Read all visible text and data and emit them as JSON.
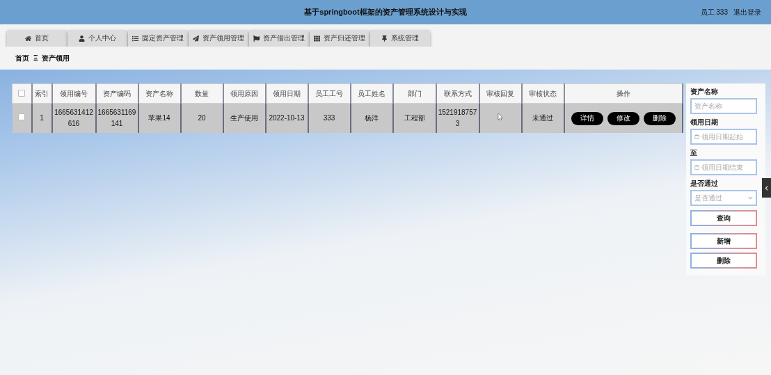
{
  "header": {
    "title": "基于springboot框架的资产管理系统设计与实现",
    "user": "员工 333",
    "logout": "退出登录"
  },
  "nav": [
    {
      "label": "首页",
      "selected": false
    },
    {
      "label": "个人中心",
      "selected": false
    },
    {
      "label": "固定资产管理",
      "selected": false
    },
    {
      "label": "资产领用管理",
      "selected": false
    },
    {
      "label": "资产借出管理",
      "selected": false
    },
    {
      "label": "资产归还管理",
      "selected": false
    },
    {
      "label": "系统管理",
      "selected": false
    }
  ],
  "breadcrumb": {
    "home": "首页",
    "separator": "Ξ",
    "current": "资产领用"
  },
  "table": {
    "select_all_checked": false,
    "columns": [
      "索引",
      "领用编号",
      "资产编码",
      "资产名称",
      "数量",
      "领用原因",
      "领用日期",
      "员工工号",
      "员工姓名",
      "部门",
      "联系方式",
      "审核回复",
      "审核状态",
      "操作"
    ],
    "rows": [
      {
        "checked": false,
        "cells": [
          "1",
          "1665631412616",
          "1665631169141",
          "苹果14",
          "20",
          "生产使用",
          "2022-10-13",
          "333",
          "杨洋",
          "工程部",
          "15219187573",
          "",
          "未通过"
        ],
        "actions": [
          "详情",
          "修改",
          "删除"
        ]
      }
    ]
  },
  "search": {
    "fields": [
      {
        "kind": "text",
        "label": "资产名称",
        "placeholder": "资产名称"
      },
      {
        "kind": "date",
        "label": "领用日期",
        "placeholder": "领用日期起始"
      },
      {
        "kind": "date",
        "label": "至",
        "placeholder": "领用日期结束"
      },
      {
        "kind": "select",
        "label": "是否通过",
        "placeholder": "是否通过"
      }
    ],
    "buttons": [
      "查询",
      "新增",
      "删除"
    ]
  }
}
